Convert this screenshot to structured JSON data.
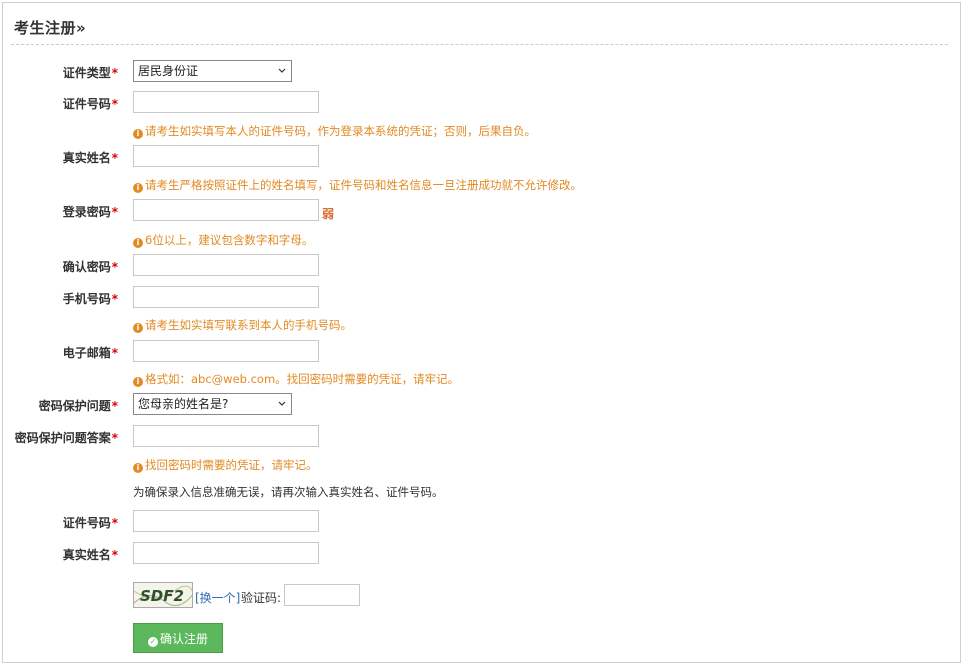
{
  "page": {
    "title": "考生注册»"
  },
  "form": {
    "id_type": {
      "label": "证件类型",
      "value": "居民身份证"
    },
    "id_number": {
      "label": "证件号码",
      "hint": "请考生如实填写本人的证件号码，作为登录本系统的凭证；否则，后果自负。"
    },
    "real_name": {
      "label": "真实姓名",
      "hint": "请考生严格按照证件上的姓名填写，证件号码和姓名信息一旦注册成功就不允许修改。"
    },
    "password": {
      "label": "登录密码",
      "strength": "弱",
      "hint": "6位以上，建议包含数字和字母。"
    },
    "confirm_password": {
      "label": "确认密码"
    },
    "phone": {
      "label": "手机号码",
      "hint": "请考生如实填写联系到本人的手机号码。"
    },
    "email": {
      "label": "电子邮箱",
      "hint": "格式如：abc@web.com。找回密码时需要的凭证，请牢记。"
    },
    "security_question": {
      "label": "密码保护问题",
      "value": "您母亲的姓名是?"
    },
    "security_answer": {
      "label": "密码保护问题答案",
      "hint": "找回密码时需要的凭证，请牢记。"
    },
    "reconfirm_note": "为确保录入信息准确无误，请再次输入真实姓名、证件号码。",
    "id_number_again": {
      "label": "证件号码"
    },
    "real_name_again": {
      "label": "真实姓名"
    },
    "captcha": {
      "image_text": "SDF2",
      "refresh_label": "[换一个]",
      "label": "验证码:"
    },
    "submit_label": "确认注册",
    "required_mark": "*"
  },
  "colors": {
    "hint": "#e28a23",
    "required": "#dd0000",
    "submit_bg": "#5cb85c",
    "link": "#2e6db4",
    "strength_weak": "#d86b2f"
  },
  "icons": {
    "hint": "info-circle-icon",
    "submit": "check-circle-icon",
    "select": "chevron-down-icon"
  }
}
